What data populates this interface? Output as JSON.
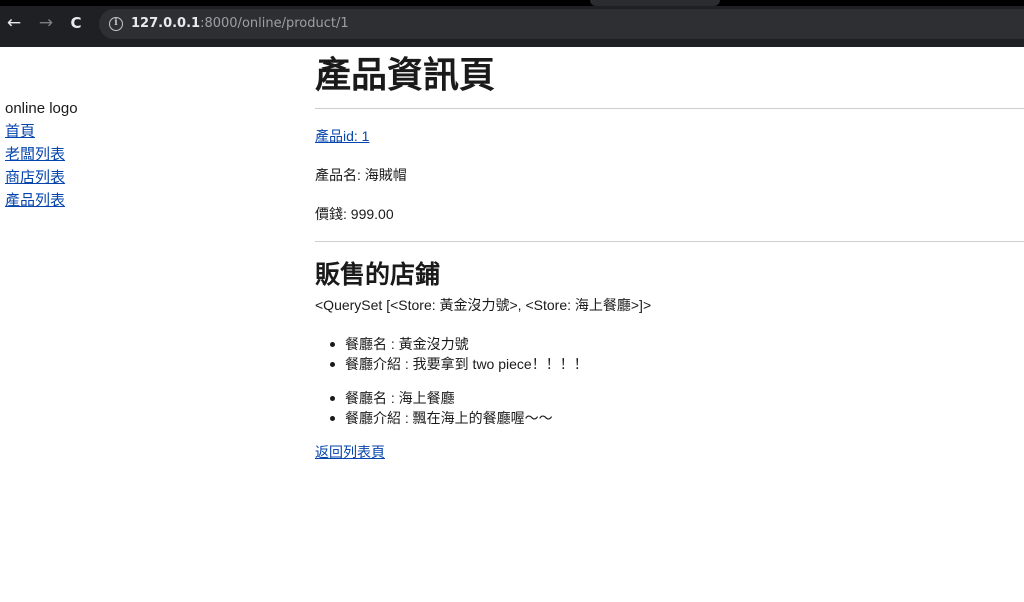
{
  "browser": {
    "url_host": "127.0.0.1",
    "url_rest": ":8000/online/product/1",
    "back_glyph": "←",
    "forward_glyph": "→",
    "reload_glyph": "C",
    "info_glyph": "i"
  },
  "sidebar": {
    "logo_text": "online logo",
    "links": [
      "首頁",
      "老闆列表",
      "商店列表",
      "產品列表"
    ]
  },
  "product": {
    "page_title": "產品資訊頁",
    "id_text": "產品id: 1",
    "name_text": "產品名: 海賊帽",
    "price_text": "價錢: 999.00"
  },
  "stores_section": {
    "title": "販售的店鋪",
    "queryset_text": "<QuerySet [<Store: 黃金沒力號>, <Store: 海上餐廳>]>",
    "stores": [
      {
        "name_text": "餐廳名 : 黃金沒力號",
        "intro_text": "餐廳介紹 : 我要拿到 two piece！！！！"
      },
      {
        "name_text": "餐廳名 : 海上餐廳",
        "intro_text": "餐廳介紹 : 飄在海上的餐廳喔～～"
      }
    ]
  },
  "back_link": "返回列表頁"
}
